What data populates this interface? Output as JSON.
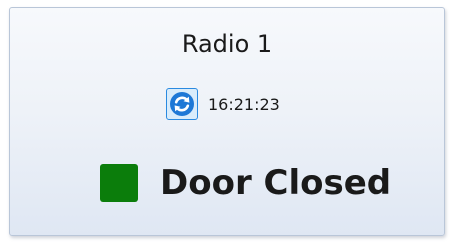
{
  "radio": {
    "title": "Radio 1",
    "time": "16:21:23",
    "refresh_icon": "refresh-icon",
    "status": {
      "label": "Door Closed",
      "indicator_color": "#0b7d0b"
    }
  },
  "colors": {
    "accent": "#2a8ae0",
    "status_ok": "#0b7d0b"
  }
}
